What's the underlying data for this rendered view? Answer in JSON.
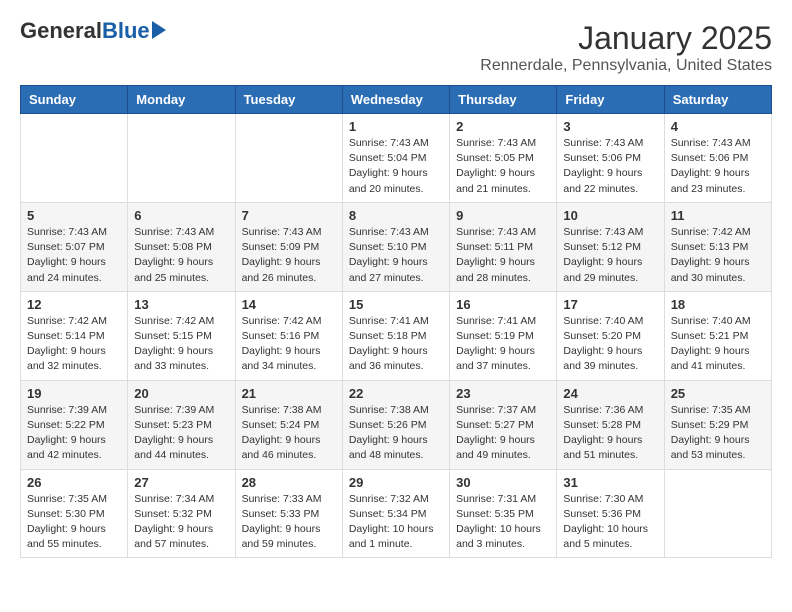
{
  "header": {
    "title": "January 2025",
    "subtitle": "Rennerdale, Pennsylvania, United States",
    "logo_general": "General",
    "logo_blue": "Blue"
  },
  "weekdays": [
    "Sunday",
    "Monday",
    "Tuesday",
    "Wednesday",
    "Thursday",
    "Friday",
    "Saturday"
  ],
  "weeks": [
    [
      {
        "day": "",
        "info": ""
      },
      {
        "day": "",
        "info": ""
      },
      {
        "day": "",
        "info": ""
      },
      {
        "day": "1",
        "info": "Sunrise: 7:43 AM\nSunset: 5:04 PM\nDaylight: 9 hours\nand 20 minutes."
      },
      {
        "day": "2",
        "info": "Sunrise: 7:43 AM\nSunset: 5:05 PM\nDaylight: 9 hours\nand 21 minutes."
      },
      {
        "day": "3",
        "info": "Sunrise: 7:43 AM\nSunset: 5:06 PM\nDaylight: 9 hours\nand 22 minutes."
      },
      {
        "day": "4",
        "info": "Sunrise: 7:43 AM\nSunset: 5:06 PM\nDaylight: 9 hours\nand 23 minutes."
      }
    ],
    [
      {
        "day": "5",
        "info": "Sunrise: 7:43 AM\nSunset: 5:07 PM\nDaylight: 9 hours\nand 24 minutes."
      },
      {
        "day": "6",
        "info": "Sunrise: 7:43 AM\nSunset: 5:08 PM\nDaylight: 9 hours\nand 25 minutes."
      },
      {
        "day": "7",
        "info": "Sunrise: 7:43 AM\nSunset: 5:09 PM\nDaylight: 9 hours\nand 26 minutes."
      },
      {
        "day": "8",
        "info": "Sunrise: 7:43 AM\nSunset: 5:10 PM\nDaylight: 9 hours\nand 27 minutes."
      },
      {
        "day": "9",
        "info": "Sunrise: 7:43 AM\nSunset: 5:11 PM\nDaylight: 9 hours\nand 28 minutes."
      },
      {
        "day": "10",
        "info": "Sunrise: 7:43 AM\nSunset: 5:12 PM\nDaylight: 9 hours\nand 29 minutes."
      },
      {
        "day": "11",
        "info": "Sunrise: 7:42 AM\nSunset: 5:13 PM\nDaylight: 9 hours\nand 30 minutes."
      }
    ],
    [
      {
        "day": "12",
        "info": "Sunrise: 7:42 AM\nSunset: 5:14 PM\nDaylight: 9 hours\nand 32 minutes."
      },
      {
        "day": "13",
        "info": "Sunrise: 7:42 AM\nSunset: 5:15 PM\nDaylight: 9 hours\nand 33 minutes."
      },
      {
        "day": "14",
        "info": "Sunrise: 7:42 AM\nSunset: 5:16 PM\nDaylight: 9 hours\nand 34 minutes."
      },
      {
        "day": "15",
        "info": "Sunrise: 7:41 AM\nSunset: 5:18 PM\nDaylight: 9 hours\nand 36 minutes."
      },
      {
        "day": "16",
        "info": "Sunrise: 7:41 AM\nSunset: 5:19 PM\nDaylight: 9 hours\nand 37 minutes."
      },
      {
        "day": "17",
        "info": "Sunrise: 7:40 AM\nSunset: 5:20 PM\nDaylight: 9 hours\nand 39 minutes."
      },
      {
        "day": "18",
        "info": "Sunrise: 7:40 AM\nSunset: 5:21 PM\nDaylight: 9 hours\nand 41 minutes."
      }
    ],
    [
      {
        "day": "19",
        "info": "Sunrise: 7:39 AM\nSunset: 5:22 PM\nDaylight: 9 hours\nand 42 minutes."
      },
      {
        "day": "20",
        "info": "Sunrise: 7:39 AM\nSunset: 5:23 PM\nDaylight: 9 hours\nand 44 minutes."
      },
      {
        "day": "21",
        "info": "Sunrise: 7:38 AM\nSunset: 5:24 PM\nDaylight: 9 hours\nand 46 minutes."
      },
      {
        "day": "22",
        "info": "Sunrise: 7:38 AM\nSunset: 5:26 PM\nDaylight: 9 hours\nand 48 minutes."
      },
      {
        "day": "23",
        "info": "Sunrise: 7:37 AM\nSunset: 5:27 PM\nDaylight: 9 hours\nand 49 minutes."
      },
      {
        "day": "24",
        "info": "Sunrise: 7:36 AM\nSunset: 5:28 PM\nDaylight: 9 hours\nand 51 minutes."
      },
      {
        "day": "25",
        "info": "Sunrise: 7:35 AM\nSunset: 5:29 PM\nDaylight: 9 hours\nand 53 minutes."
      }
    ],
    [
      {
        "day": "26",
        "info": "Sunrise: 7:35 AM\nSunset: 5:30 PM\nDaylight: 9 hours\nand 55 minutes."
      },
      {
        "day": "27",
        "info": "Sunrise: 7:34 AM\nSunset: 5:32 PM\nDaylight: 9 hours\nand 57 minutes."
      },
      {
        "day": "28",
        "info": "Sunrise: 7:33 AM\nSunset: 5:33 PM\nDaylight: 9 hours\nand 59 minutes."
      },
      {
        "day": "29",
        "info": "Sunrise: 7:32 AM\nSunset: 5:34 PM\nDaylight: 10 hours\nand 1 minute."
      },
      {
        "day": "30",
        "info": "Sunrise: 7:31 AM\nSunset: 5:35 PM\nDaylight: 10 hours\nand 3 minutes."
      },
      {
        "day": "31",
        "info": "Sunrise: 7:30 AM\nSunset: 5:36 PM\nDaylight: 10 hours\nand 5 minutes."
      },
      {
        "day": "",
        "info": ""
      }
    ]
  ]
}
